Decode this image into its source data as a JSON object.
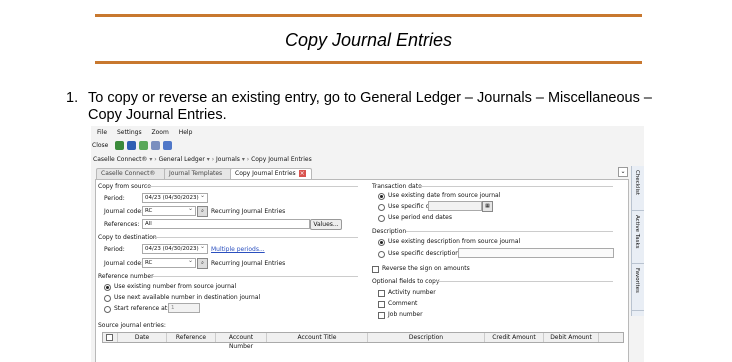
{
  "doc": {
    "title": "Copy Journal Entries",
    "step_number": "1.",
    "step_text": "To copy or reverse an existing entry, go to General Ledger – Journals – Miscellaneous – Copy Journal Entries."
  },
  "app": {
    "menu": [
      "File",
      "Settings",
      "Zoom",
      "Help"
    ],
    "toolbar": {
      "close_label": "Close"
    },
    "breadcrumb": [
      "Caselle Connect®",
      "General Ledger",
      "Journals",
      "Copy Journal Entries"
    ],
    "tabs": [
      "Caselle Connect®",
      "Journal Templates",
      "Copy Journal Entries"
    ],
    "copy_from": {
      "header": "Copy from source",
      "period_label": "Period:",
      "period_value": "04/23 (04/30/2023)",
      "journal_label": "Journal code:",
      "journal_value": "RC",
      "journal_desc": "Recurring Journal Entries",
      "references_label": "References:",
      "references_value": "All",
      "values_button": "Values..."
    },
    "copy_to": {
      "header": "Copy to destination",
      "period_label": "Period:",
      "period_value": "04/23 (04/30/2023)",
      "multiple_periods": "Multiple periods...",
      "journal_label": "Journal code:",
      "journal_value": "RC",
      "journal_desc": "Recurring Journal Entries"
    },
    "reference_number": {
      "header": "Reference number",
      "opt1": "Use existing number from source journal",
      "opt2": "Use next available number in destination journal",
      "opt3": "Start reference at:",
      "start_value": "1"
    },
    "transaction_date": {
      "header": "Transaction date",
      "opt1": "Use existing date from source journal",
      "opt2": "Use specific date:",
      "opt3": "Use period end dates"
    },
    "description": {
      "header": "Description",
      "opt1": "Use existing description from source journal",
      "opt2": "Use specific description:"
    },
    "reverse_label": "Reverse the sign on amounts",
    "optional": {
      "header": "Optional fields to copy",
      "f1": "Activity number",
      "f2": "Comment",
      "f3": "Job number"
    },
    "grid": {
      "label": "Source journal entries:",
      "columns": [
        "Date",
        "Reference",
        "Account Number",
        "Account Title",
        "Description",
        "Credit Amount",
        "Debit Amount"
      ]
    },
    "side_tabs": [
      "Checklist",
      "Active Tasks",
      "Favorites"
    ]
  }
}
